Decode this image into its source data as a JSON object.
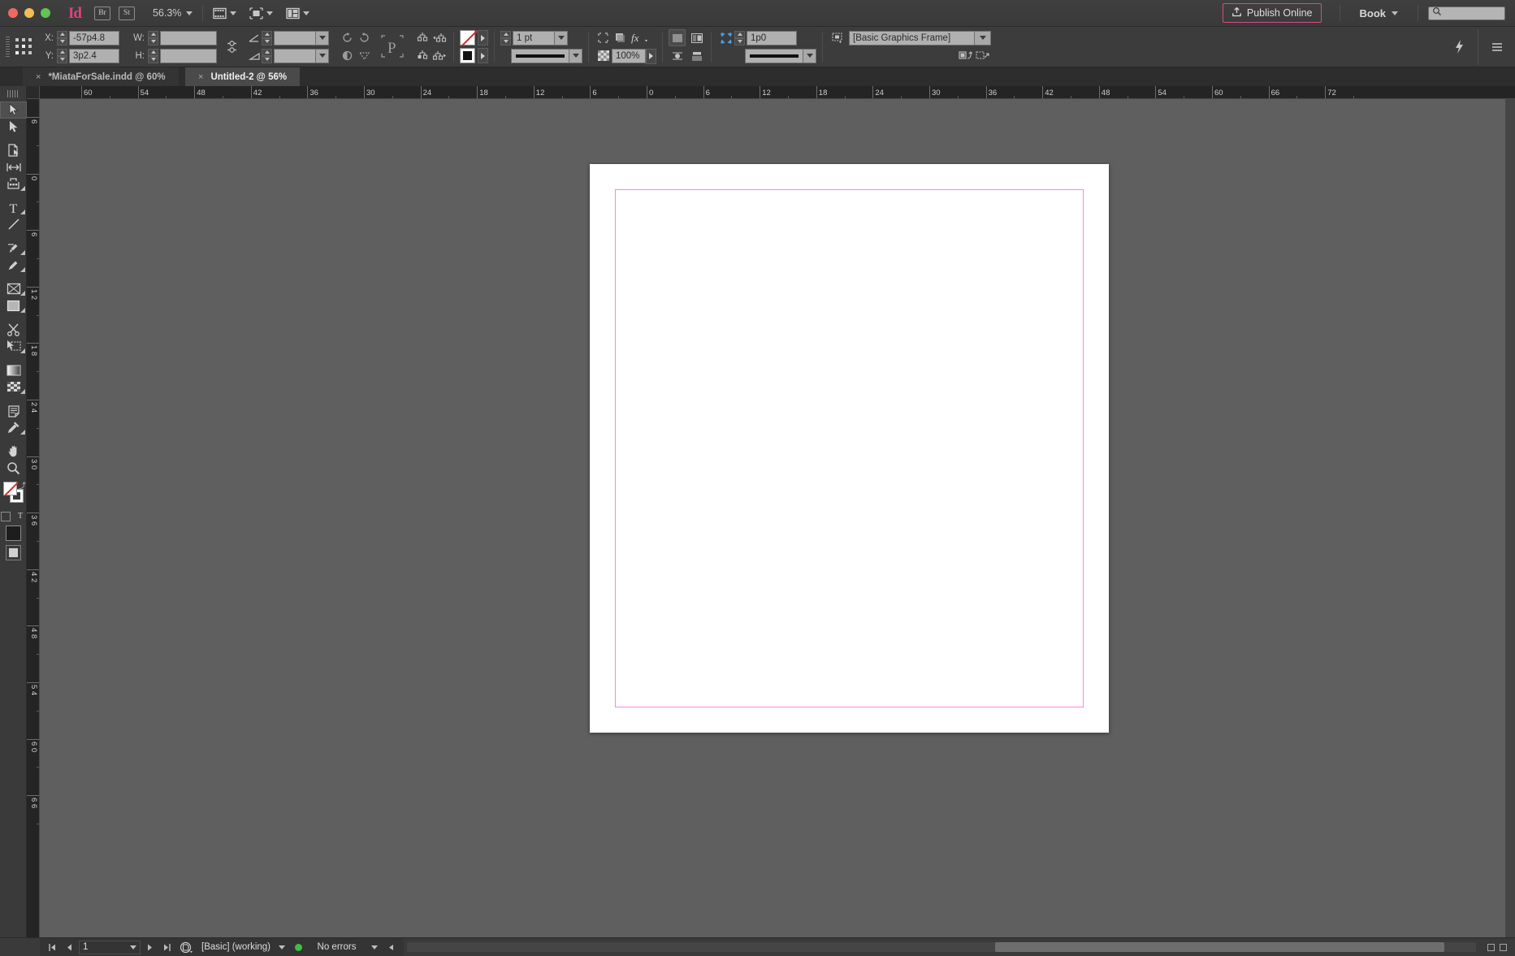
{
  "app": {
    "name": "Adobe InDesign",
    "logo_text": "Id",
    "window_controls": [
      "close",
      "minimize",
      "maximize"
    ]
  },
  "appbar": {
    "bridge_label": "Br",
    "stock_label": "St",
    "zoom_level": "56.3%",
    "view_buttons": [
      "screen-mode-icon",
      "view-mode-icon",
      "arrange-documents-icon"
    ],
    "publish_label": "Publish Online",
    "publish_border_color": "#d34d86",
    "book_label": "Book",
    "search_placeholder": "",
    "search_value": ""
  },
  "control_panel": {
    "x_label": "X:",
    "x_value": "-57p4.8",
    "y_label": "Y:",
    "y_value": "3p2.4",
    "w_label": "W:",
    "w_value": "",
    "h_label": "H:",
    "h_value": "",
    "scale_x_value": "",
    "scale_y_value": "",
    "rotate_value": "",
    "shear_value": "",
    "stroke_weight": "1 pt",
    "opacity_value": "100%",
    "corner_radius": "1p0",
    "object_style": "[Basic Graphics Frame]",
    "icons": {
      "reference_point": "reference-point-proxy-icon",
      "constrain": "constrain-proportions-icon",
      "flip": "flip-icon",
      "rotate_ccw": "rotate-counterclockwise-icon",
      "rotate_cw": "rotate-clockwise-icon",
      "placeholder_p": "text-frame-p-icon",
      "align_top": "distribute-top-icon",
      "align_mid": "distribute-mid-icon",
      "corner_options": "corner-options-icon",
      "effects": "fx-icon",
      "frame_fitting": "frame-fitting-icon",
      "text_wrap": "text-wrap-icon",
      "quick_apply": "quick-apply-lightning-icon",
      "panel_menu": "panel-menu-icon"
    }
  },
  "tabs": [
    {
      "label": "*MiataForSale.indd @ 60%",
      "active": false,
      "close": "×"
    },
    {
      "label": "Untitled-2 @ 56%",
      "active": true,
      "close": "×"
    }
  ],
  "toolbox": {
    "tools": [
      {
        "name": "selection-tool",
        "glyph": "sel",
        "selected": true,
        "flyout": false
      },
      {
        "name": "direct-selection-tool",
        "glyph": "dsel",
        "selected": false,
        "flyout": false
      },
      {
        "name": "page-tool",
        "glyph": "page",
        "selected": false,
        "flyout": false
      },
      {
        "name": "gap-tool",
        "glyph": "gap",
        "selected": false,
        "flyout": false
      },
      {
        "name": "content-collector-tool",
        "glyph": "collect",
        "selected": false,
        "flyout": true
      },
      {
        "name": "type-tool",
        "glyph": "type",
        "selected": false,
        "flyout": true
      },
      {
        "name": "line-tool",
        "glyph": "line",
        "selected": false,
        "flyout": false
      },
      {
        "name": "pen-tool",
        "glyph": "pen",
        "selected": false,
        "flyout": true
      },
      {
        "name": "pencil-tool",
        "glyph": "pencil",
        "selected": false,
        "flyout": true
      },
      {
        "name": "rectangle-frame-tool",
        "glyph": "frame",
        "selected": false,
        "flyout": true
      },
      {
        "name": "rectangle-tool",
        "glyph": "rect",
        "selected": false,
        "flyout": true
      },
      {
        "name": "scissors-tool",
        "glyph": "scissor",
        "selected": false,
        "flyout": false
      },
      {
        "name": "free-transform-tool",
        "glyph": "xform",
        "selected": false,
        "flyout": true
      },
      {
        "name": "gradient-swatch-tool",
        "glyph": "grad",
        "selected": false,
        "flyout": false
      },
      {
        "name": "gradient-feather-tool",
        "glyph": "feather",
        "selected": false,
        "flyout": true
      },
      {
        "name": "note-tool",
        "glyph": "note",
        "selected": false,
        "flyout": false
      },
      {
        "name": "eyedropper-tool",
        "glyph": "dropper",
        "selected": false,
        "flyout": true
      },
      {
        "name": "hand-tool",
        "glyph": "hand",
        "selected": false,
        "flyout": false
      },
      {
        "name": "zoom-tool",
        "glyph": "zoom",
        "selected": false,
        "flyout": false
      }
    ],
    "fill_label": "fill-swatch",
    "stroke_label": "stroke-swatch",
    "swap_label": "swap-fill-stroke-icon",
    "screen_mode_label": "normal-view-mode-icon"
  },
  "rulers": {
    "units": "picas",
    "horizontal_labels": [
      "60",
      "54",
      "48",
      "42",
      "36",
      "30",
      "24",
      "18",
      "12",
      "6",
      "0",
      "6",
      "12",
      "18",
      "24",
      "30",
      "36",
      "42",
      "48",
      "54",
      "60",
      "66",
      "72"
    ],
    "vertical_labels": [
      "6",
      "0",
      "6",
      "1 2",
      "1 8",
      "2 4",
      "3 0",
      "3 6",
      "4 2",
      "4 8",
      "5 4",
      "6 0",
      "6 6"
    ]
  },
  "canvas": {
    "page_background": "#ffffff",
    "pasteboard_color": "#5f5f5f",
    "margin_guide_color": "#ff7ff0"
  },
  "statusbar": {
    "page_number": "1",
    "preflight_profile": "[Basic] (working)",
    "error_status": "No errors",
    "error_color": "#3fbf3f",
    "first_page_icon": "first-page-icon",
    "prev_page_icon": "previous-page-icon",
    "next_page_icon": "next-page-icon",
    "last_page_icon": "last-page-icon",
    "preflight_icon": "preflight-icon"
  }
}
